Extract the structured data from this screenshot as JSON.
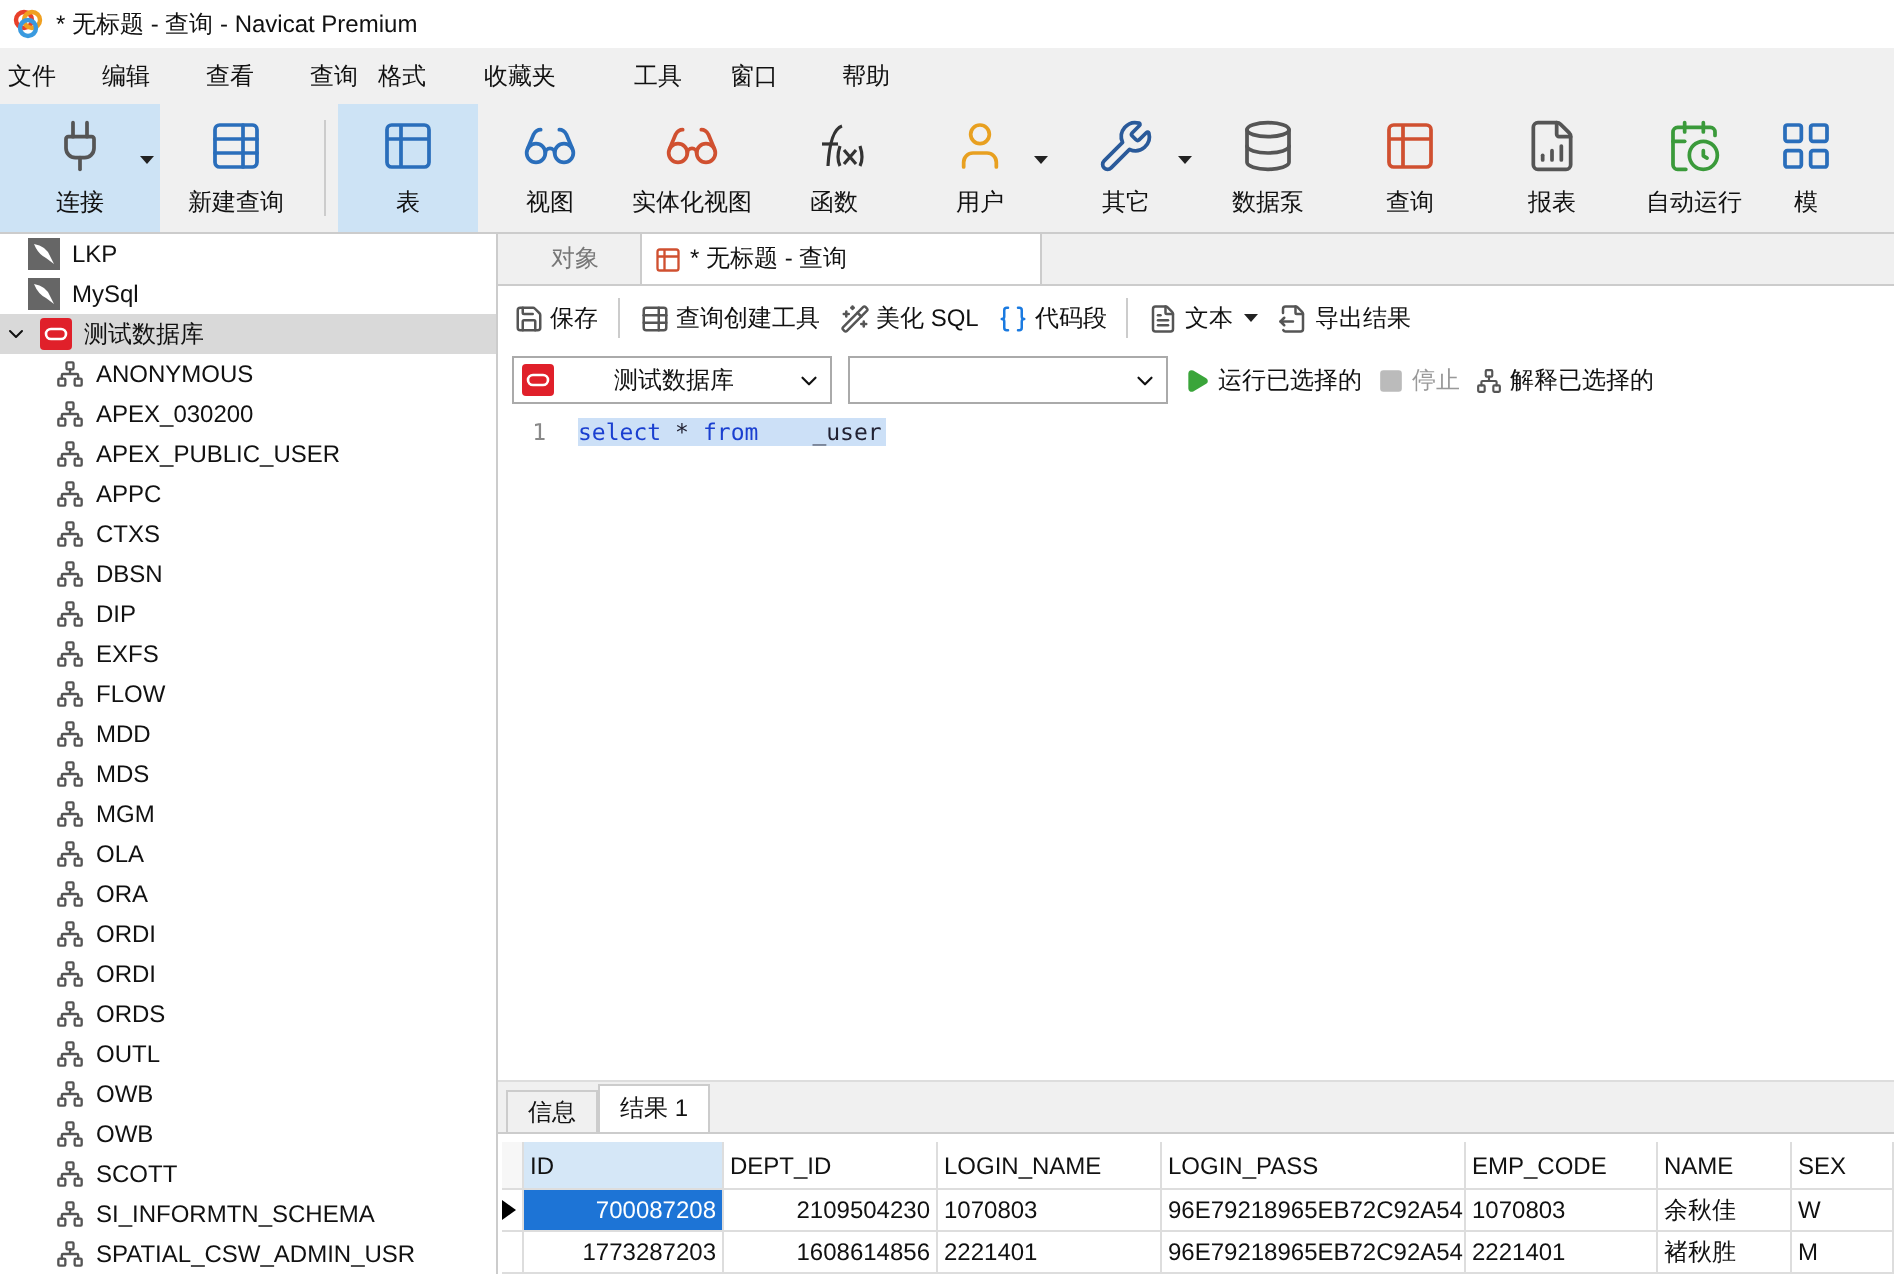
{
  "window": {
    "title": "* 无标题 - 查询 - Navicat Premium"
  },
  "menu": [
    "文件",
    "编辑",
    "查看",
    "查询",
    "格式",
    "收藏夹",
    "工具",
    "窗口",
    "帮助"
  ],
  "toolbar": [
    {
      "kind": "connect",
      "label": "连接",
      "selected": true,
      "dropdown": true
    },
    {
      "kind": "newquery",
      "label": "新建查询",
      "selected": false,
      "dropdown": false
    },
    {
      "kind": "table",
      "label": "表",
      "selected": true,
      "dropdown": false
    },
    {
      "kind": "view",
      "label": "视图",
      "selected": false,
      "dropdown": false
    },
    {
      "kind": "mview",
      "label": "实体化视图",
      "selected": false,
      "dropdown": false
    },
    {
      "kind": "function",
      "label": "函数",
      "selected": false,
      "dropdown": false
    },
    {
      "kind": "user",
      "label": "用户",
      "selected": false,
      "dropdown": true
    },
    {
      "kind": "other",
      "label": "其它",
      "selected": false,
      "dropdown": true
    },
    {
      "kind": "pump",
      "label": "数据泵",
      "selected": false,
      "dropdown": false
    },
    {
      "kind": "query",
      "label": "查询",
      "selected": false,
      "dropdown": false
    },
    {
      "kind": "report",
      "label": "报表",
      "selected": false,
      "dropdown": false
    },
    {
      "kind": "schedule",
      "label": "自动运行",
      "selected": false,
      "dropdown": false
    },
    {
      "kind": "model",
      "label": "模",
      "selected": false,
      "dropdown": false
    }
  ],
  "sidebar": {
    "items": [
      {
        "kind": "mysql",
        "label": "LKP",
        "selected": false
      },
      {
        "kind": "mysql",
        "label": "MySql",
        "selected": false
      },
      {
        "kind": "oracle",
        "label": "测试数据库",
        "selected": true,
        "expanded": true,
        "children": [
          {
            "label": "ANONYMOUS"
          },
          {
            "label": "APEX_030200"
          },
          {
            "label": "APEX_PUBLIC_USER"
          },
          {
            "label": "APPC"
          },
          {
            "label": "CTXS"
          },
          {
            "label": "DBSN"
          },
          {
            "label": "DIP"
          },
          {
            "label": "EXFS"
          },
          {
            "label": "FLOW"
          },
          {
            "label": "MDD"
          },
          {
            "label": "MDS"
          },
          {
            "label": "MGM"
          },
          {
            "label": "OLA"
          },
          {
            "label": "ORA"
          },
          {
            "label": "ORDI"
          },
          {
            "label": "ORDI"
          },
          {
            "label": "ORDS"
          },
          {
            "label": "OUTL"
          },
          {
            "label": "OWB"
          },
          {
            "label": "OWB"
          },
          {
            "label": "SCOTT"
          },
          {
            "label": "SI_INFORMTN_SCHEMA"
          },
          {
            "label": "SPATIAL_CSW_ADMIN_USR"
          }
        ]
      }
    ]
  },
  "tabs": [
    {
      "label": "对象",
      "selected": false,
      "kind": "plain"
    },
    {
      "label": "* 无标题 - 查询",
      "selected": true,
      "kind": "query"
    }
  ],
  "query_toolbar": [
    {
      "kind": "save",
      "label": "保存",
      "dropdown": false
    },
    {
      "kind": "builder",
      "label": "查询创建工具",
      "dropdown": false
    },
    {
      "kind": "beautify",
      "label": "美化 SQL",
      "dropdown": false
    },
    {
      "kind": "snippet",
      "label": "代码段",
      "dropdown": false
    },
    {
      "kind": "text",
      "label": "文本",
      "dropdown": true
    },
    {
      "kind": "export",
      "label": "导出结果",
      "dropdown": false
    }
  ],
  "connection_select": {
    "value": "测试数据库"
  },
  "run_bar": [
    {
      "kind": "run",
      "label": "运行已选择的",
      "disabled": false
    },
    {
      "kind": "stop",
      "label": "停止",
      "disabled": true
    },
    {
      "kind": "explain",
      "label": "解释已选择的",
      "disabled": false
    }
  ],
  "editor": {
    "lines": [
      {
        "number": "1",
        "tokens": [
          {
            "kind": "keyword",
            "text": "select"
          },
          {
            "kind": "plain",
            "text": "*"
          },
          {
            "kind": "keyword",
            "text": "from"
          },
          {
            "kind": "plain",
            "text": "_user"
          }
        ]
      }
    ]
  },
  "result_tabs": [
    {
      "label": "信息",
      "selected": false
    },
    {
      "label": "结果 1",
      "selected": true
    }
  ],
  "table": {
    "columns": [
      {
        "label": "ID",
        "selected": true
      },
      {
        "label": "DEPT_ID",
        "selected": false
      },
      {
        "label": "LOGIN_NAME",
        "selected": false
      },
      {
        "label": "LOGIN_PASS",
        "selected": false
      },
      {
        "label": "EMP_CODE",
        "selected": false
      },
      {
        "label": "NAME",
        "selected": false
      },
      {
        "label": "SEX",
        "selected": false
      }
    ],
    "rows": [
      {
        "selected": true,
        "cells": [
          "700087208",
          "2109504230",
          "1070803",
          "96E79218965EB72C92A54",
          "1070803",
          "余秋佳",
          "W"
        ]
      },
      {
        "selected": false,
        "cells": [
          "1773287203",
          "1608614856",
          "2221401",
          "96E79218965EB72C92A54",
          "2221401",
          "褚秋胜",
          "M"
        ]
      }
    ]
  }
}
